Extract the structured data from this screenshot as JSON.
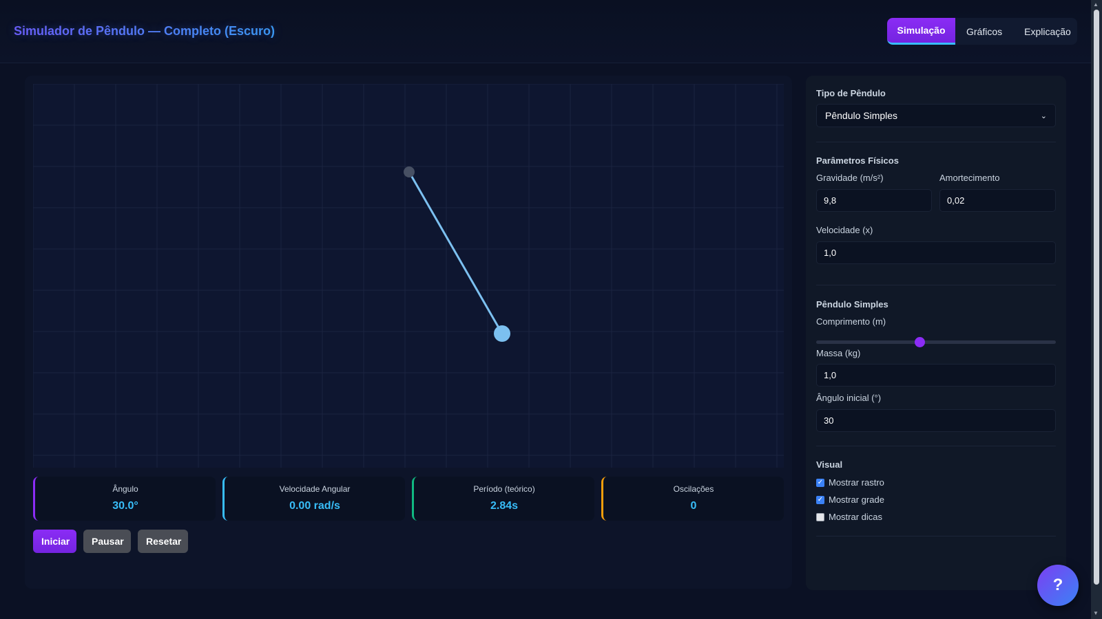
{
  "header": {
    "title": "Simulador de Pêndulo — Completo (Escuro)",
    "tabs": [
      {
        "label": "Simulação",
        "active": true
      },
      {
        "label": "Gráficos",
        "active": false
      },
      {
        "label": "Explicação",
        "active": false
      }
    ]
  },
  "stats": [
    {
      "label": "Ângulo",
      "value": "30.0°"
    },
    {
      "label": "Velocidade Angular",
      "value": "0.00 rad/s"
    },
    {
      "label": "Período (teórico)",
      "value": "2.84s"
    },
    {
      "label": "Oscilações",
      "value": "0"
    }
  ],
  "controls": {
    "start_label": "Iniciar",
    "pause_label": "Pausar",
    "reset_label": "Resetar"
  },
  "side": {
    "type_title": "Tipo de Pêndulo",
    "type_value": "Pêndulo Simples",
    "physics_title": "Parâmetros Físicos",
    "gravity_label": "Gravidade (m/s²)",
    "gravity_value": "9,8",
    "damping_label": "Amortecimento",
    "damping_value": "0,02",
    "speed_label": "Velocidade (x)",
    "speed_value": "1,0",
    "simple_title": "Pêndulo Simples",
    "length_label": "Comprimento (m)",
    "length_fraction": 0.43,
    "mass_label": "Massa (kg)",
    "mass_value": "1,0",
    "angle_label": "Ângulo inicial (°)",
    "angle_value": "30",
    "visual_title": "Visual",
    "checkboxes": [
      {
        "label": "Mostrar rastro",
        "checked": true
      },
      {
        "label": "Mostrar grade",
        "checked": true
      },
      {
        "label": "Mostrar dicas",
        "checked": false
      }
    ]
  },
  "help_label": "?",
  "colors": {
    "accent": "#8b2cf5",
    "cyan": "#38bdf8",
    "green": "#10b981",
    "amber": "#f59e0b"
  }
}
